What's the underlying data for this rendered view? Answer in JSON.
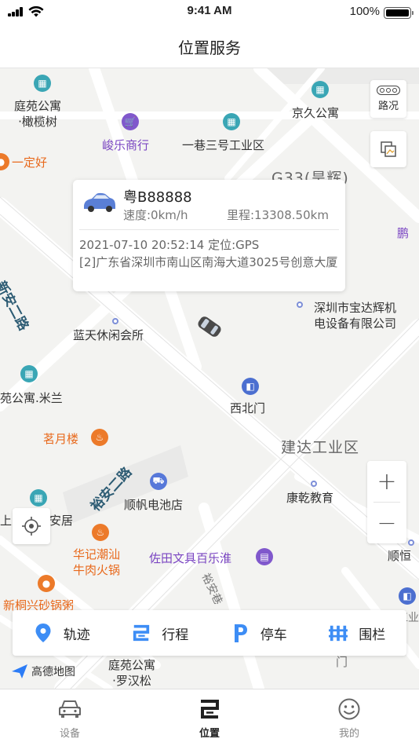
{
  "status_bar": {
    "time": "9:41 AM",
    "battery": "100%"
  },
  "nav": {
    "title": "位置服务"
  },
  "map": {
    "labels": {
      "tingyuan_olive": "庭苑公寓\n·橄榄树",
      "jiujiu": "京久公寓",
      "junle": "峻乐商行",
      "yixiang3": "一巷三号工业区",
      "yidinghao": "一定好",
      "g33": "G33(旱辉)",
      "pengcheng": "鹏",
      "xinanerlu": "新安二路",
      "lantian": "蓝天休闲会所",
      "baodahuy": "深圳市宝达辉机\n电设备有限公司",
      "milan": "苑公寓.米兰",
      "xibeimen": "西北门",
      "jianda": "建达工业区",
      "mingyuelou": "茗月楼",
      "yuan2lu": "裕安二路",
      "shunfan": "顺帆电池店",
      "kangqian": "康乾教育",
      "shangju": "上",
      "anju": "安居",
      "huaji": "华记潮汕\n牛肉火锅",
      "zuotian": "佐田文具百乐淮",
      "yuanxiang": "裕安巷",
      "shunheng": "顺恒",
      "xintongxing": "新桐兴砂锅粥",
      "jianda_west": "建达工业\n西门",
      "tingyuan_luohan": "庭苑公寓\n·罗汉松",
      "men": "门"
    },
    "popup": {
      "plate": "粤B88888",
      "speed": "速度:0km/h",
      "mileage": "里程:13308.50km",
      "time_position": "2021-07-10 20:52:14 定位:GPS",
      "address": "[2]广东省深圳市南山区南海大道3025号创意大厦"
    },
    "controls": {
      "traffic_label": "路况",
      "zoom_in": "+",
      "zoom_out": "−"
    },
    "actions": [
      {
        "label": "轨迹",
        "icon": "location-pin-icon"
      },
      {
        "label": "行程",
        "icon": "route-icon"
      },
      {
        "label": "停车",
        "icon": "parking-icon"
      },
      {
        "label": "围栏",
        "icon": "fence-icon"
      }
    ],
    "attribution": "高德地图"
  },
  "tabs": [
    {
      "label": "设备",
      "icon": "car-icon",
      "active": false
    },
    {
      "label": "位置",
      "icon": "route-icon",
      "active": true
    },
    {
      "label": "我的",
      "icon": "smile-icon",
      "active": false
    }
  ],
  "colors": {
    "accent": "#3d8df5",
    "map_bg": "#f3f3f1",
    "road": "#ffffff"
  }
}
